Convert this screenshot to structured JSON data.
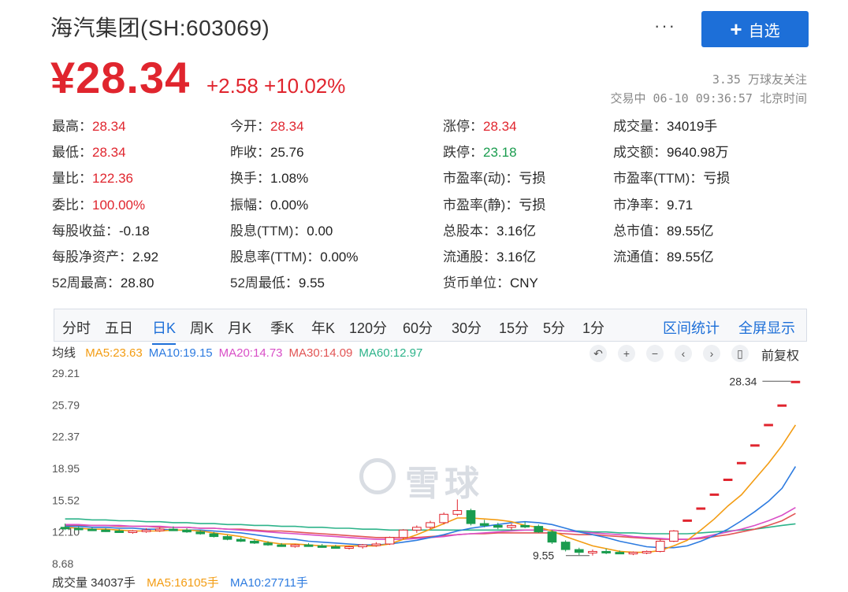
{
  "header": {
    "title": "海汽集团(SH:603069)",
    "more": "···",
    "add_button": "自选",
    "add_icon": "plus-icon"
  },
  "quote": {
    "price": "¥28.34",
    "change": "+2.58  +10.02%",
    "followers": "3.35 万球友关注",
    "trade_time": "交易中 06-10 09:36:57 北京时间"
  },
  "stats": [
    {
      "label": "最高：",
      "value": "28.34",
      "color": "red"
    },
    {
      "label": "今开：",
      "value": "28.34",
      "color": "red"
    },
    {
      "label": "涨停：",
      "value": "28.34",
      "color": "red"
    },
    {
      "label": "成交量：",
      "value": "34019手",
      "color": ""
    },
    {
      "label": "最低：",
      "value": "28.34",
      "color": "red"
    },
    {
      "label": "昨收：",
      "value": "25.76",
      "color": ""
    },
    {
      "label": "跌停：",
      "value": "23.18",
      "color": "green"
    },
    {
      "label": "成交额：",
      "value": "9640.98万",
      "color": ""
    },
    {
      "label": "量比：",
      "value": "122.36",
      "color": "red"
    },
    {
      "label": "换手：",
      "value": "1.08%",
      "color": ""
    },
    {
      "label": "市盈率(动)：",
      "value": "亏损",
      "color": ""
    },
    {
      "label": "市盈率(TTM)：",
      "value": "亏损",
      "color": ""
    },
    {
      "label": "委比：",
      "value": "100.00%",
      "color": "red"
    },
    {
      "label": "振幅：",
      "value": "0.00%",
      "color": ""
    },
    {
      "label": "市盈率(静)：",
      "value": "亏损",
      "color": ""
    },
    {
      "label": "市净率：",
      "value": "9.71",
      "color": ""
    },
    {
      "label": "每股收益：",
      "value": "-0.18",
      "color": ""
    },
    {
      "label": "股息(TTM)：",
      "value": "0.00",
      "color": ""
    },
    {
      "label": "总股本：",
      "value": "3.16亿",
      "color": ""
    },
    {
      "label": "总市值：",
      "value": "89.55亿",
      "color": ""
    },
    {
      "label": "每股净资产：",
      "value": "2.92",
      "color": ""
    },
    {
      "label": "股息率(TTM)：",
      "value": "0.00%",
      "color": ""
    },
    {
      "label": "流通股：",
      "value": "3.16亿",
      "color": ""
    },
    {
      "label": "流通值：",
      "value": "89.55亿",
      "color": ""
    },
    {
      "label": "52周最高：",
      "value": "28.80",
      "color": ""
    },
    {
      "label": "52周最低：",
      "value": "9.55",
      "color": ""
    },
    {
      "label": "货币单位：",
      "value": "CNY",
      "color": ""
    }
  ],
  "tabs": [
    "分时",
    "五日",
    "日K",
    "周K",
    "月K",
    "季K",
    "年K",
    "120分",
    "60分",
    "30分",
    "15分",
    "5分",
    "1分"
  ],
  "active_tab": "日K",
  "tab_links": [
    "区间统计",
    "全屏显示"
  ],
  "ma": {
    "label": "均线",
    "items": [
      {
        "text": "MA5:23.63",
        "color": "#f39c12"
      },
      {
        "text": "MA10:19.15",
        "color": "#2d7be0"
      },
      {
        "text": "MA20:14.73",
        "color": "#d94fc7"
      },
      {
        "text": "MA30:14.09",
        "color": "#e25555"
      },
      {
        "text": "MA60:12.97",
        "color": "#2db38a"
      }
    ]
  },
  "chart_tools": [
    "undo-icon",
    "zoom-in-icon",
    "zoom-out-icon",
    "prev-icon",
    "next-icon",
    "fullscreen-icon"
  ],
  "chart_tool_glyphs": [
    "↶",
    "+",
    "−",
    "‹",
    "›",
    "▯"
  ],
  "adjust_label": "前复权",
  "volume": {
    "label": "成交量 34037手",
    "ma5": "MA5:16105手",
    "ma10": "MA10:27711手"
  },
  "watermark": "雪球",
  "chart_data": {
    "type": "candlestick",
    "y_ticks": [
      "29.21",
      "25.79",
      "22.37",
      "18.95",
      "15.52",
      "12.10",
      "8.68"
    ],
    "ylim": [
      8.68,
      29.21
    ],
    "annotations": {
      "high": "28.34",
      "low": "9.55"
    },
    "colors": {
      "up": "#e0252e",
      "down": "#1a9c4e",
      "ma5": "#f39c12",
      "ma10": "#2d7be0",
      "ma20": "#d94fc7",
      "ma30": "#e25555",
      "ma60": "#2db38a"
    },
    "candles": [
      [
        12.6,
        13.0,
        12.3,
        12.5
      ],
      [
        12.5,
        12.7,
        12.3,
        12.4
      ],
      [
        12.4,
        12.6,
        12.2,
        12.3
      ],
      [
        12.3,
        12.5,
        12.1,
        12.2
      ],
      [
        12.2,
        12.4,
        12.0,
        12.1
      ],
      [
        12.1,
        12.3,
        11.9,
        12.2
      ],
      [
        12.2,
        12.5,
        12.0,
        12.3
      ],
      [
        12.3,
        12.6,
        12.1,
        12.4
      ],
      [
        12.4,
        12.7,
        12.2,
        12.3
      ],
      [
        12.3,
        12.5,
        12.0,
        12.1
      ],
      [
        12.1,
        12.3,
        11.8,
        11.9
      ],
      [
        11.9,
        12.1,
        11.5,
        11.6
      ],
      [
        11.6,
        11.8,
        11.2,
        11.3
      ],
      [
        11.3,
        11.5,
        11.0,
        11.1
      ],
      [
        11.1,
        11.3,
        10.8,
        10.9
      ],
      [
        10.9,
        11.1,
        10.6,
        10.7
      ],
      [
        10.7,
        10.9,
        10.5,
        10.6
      ],
      [
        10.6,
        10.8,
        10.4,
        10.7
      ],
      [
        10.7,
        10.9,
        10.5,
        10.6
      ],
      [
        10.6,
        10.8,
        10.4,
        10.5
      ],
      [
        10.5,
        10.7,
        10.3,
        10.4
      ],
      [
        10.4,
        10.6,
        10.2,
        10.5
      ],
      [
        10.5,
        10.8,
        10.3,
        10.7
      ],
      [
        10.7,
        11.0,
        10.5,
        10.8
      ],
      [
        10.8,
        11.6,
        10.7,
        11.5
      ],
      [
        11.5,
        12.4,
        11.3,
        12.3
      ],
      [
        12.3,
        12.8,
        12.0,
        12.6
      ],
      [
        12.6,
        13.3,
        12.4,
        13.1
      ],
      [
        13.1,
        14.2,
        12.9,
        14.0
      ],
      [
        14.0,
        15.6,
        13.8,
        14.4
      ],
      [
        14.4,
        14.6,
        12.8,
        13.0
      ],
      [
        13.0,
        13.4,
        12.6,
        12.8
      ],
      [
        12.8,
        13.1,
        12.4,
        12.6
      ],
      [
        12.6,
        13.0,
        12.3,
        12.8
      ],
      [
        12.8,
        13.2,
        12.5,
        12.7
      ],
      [
        12.7,
        12.9,
        12.0,
        12.1
      ],
      [
        12.1,
        12.3,
        10.8,
        11.0
      ],
      [
        11.0,
        11.2,
        10.0,
        10.2
      ],
      [
        10.2,
        10.4,
        9.6,
        9.9
      ],
      [
        9.9,
        10.2,
        9.55,
        10.0
      ],
      [
        10.0,
        10.3,
        9.7,
        9.9
      ],
      [
        9.9,
        10.1,
        9.7,
        9.8
      ],
      [
        9.8,
        10.0,
        9.6,
        9.9
      ],
      [
        9.9,
        10.1,
        9.7,
        10.0
      ],
      [
        10.0,
        11.3,
        9.9,
        11.1
      ],
      [
        11.1,
        12.3,
        11.0,
        12.2
      ],
      [
        13.4,
        13.4,
        13.4,
        13.4
      ],
      [
        14.7,
        14.7,
        14.7,
        14.7
      ],
      [
        16.2,
        16.2,
        16.2,
        16.2
      ],
      [
        17.8,
        17.8,
        17.8,
        17.8
      ],
      [
        19.6,
        19.6,
        19.6,
        19.6
      ],
      [
        21.5,
        21.5,
        21.5,
        21.5
      ],
      [
        23.7,
        23.7,
        23.7,
        23.7
      ],
      [
        25.8,
        25.8,
        25.8,
        25.8
      ],
      [
        28.34,
        28.34,
        28.34,
        28.34
      ]
    ],
    "ma5": [
      12.6,
      12.5,
      12.4,
      12.4,
      12.3,
      12.2,
      12.2,
      12.2,
      12.3,
      12.3,
      12.2,
      12.0,
      11.8,
      11.6,
      11.3,
      11.0,
      10.8,
      10.8,
      10.7,
      10.6,
      10.6,
      10.6,
      10.6,
      10.6,
      10.8,
      11.3,
      11.8,
      12.4,
      13.0,
      13.6,
      13.6,
      13.5,
      13.4,
      13.2,
      12.8,
      12.6,
      12.2,
      11.6,
      11.1,
      10.6,
      10.3,
      10.0,
      9.9,
      9.9,
      10.1,
      10.6,
      11.2,
      12.3,
      13.5,
      14.9,
      16.1,
      17.8,
      19.5,
      21.4,
      23.63
    ],
    "ma10": [
      12.7,
      12.7,
      12.6,
      12.6,
      12.5,
      12.5,
      12.4,
      12.4,
      12.3,
      12.3,
      12.3,
      12.2,
      12.1,
      12.0,
      11.8,
      11.6,
      11.4,
      11.3,
      11.1,
      11.0,
      10.9,
      10.8,
      10.7,
      10.7,
      10.8,
      11.0,
      11.2,
      11.5,
      11.8,
      12.2,
      12.5,
      12.7,
      12.9,
      13.1,
      13.2,
      13.1,
      12.9,
      12.5,
      12.1,
      11.8,
      11.5,
      11.1,
      10.8,
      10.5,
      10.4,
      10.4,
      10.6,
      11.1,
      11.7,
      12.4,
      13.3,
      14.3,
      15.4,
      16.8,
      19.15
    ],
    "ma20": [
      12.9,
      12.9,
      12.8,
      12.8,
      12.8,
      12.7,
      12.7,
      12.7,
      12.6,
      12.6,
      12.5,
      12.5,
      12.4,
      12.3,
      12.2,
      12.1,
      12.0,
      11.9,
      11.8,
      11.7,
      11.6,
      11.5,
      11.4,
      11.3,
      11.3,
      11.3,
      11.4,
      11.5,
      11.6,
      11.8,
      11.9,
      12.0,
      12.1,
      12.2,
      12.3,
      12.3,
      12.3,
      12.2,
      12.1,
      12.0,
      11.9,
      11.8,
      11.6,
      11.5,
      11.4,
      11.3,
      11.3,
      11.5,
      11.8,
      12.1,
      12.4,
      12.8,
      13.3,
      13.9,
      14.73
    ],
    "ma30": [
      12.8,
      12.8,
      12.8,
      12.8,
      12.7,
      12.7,
      12.7,
      12.6,
      12.6,
      12.6,
      12.5,
      12.5,
      12.4,
      12.4,
      12.3,
      12.2,
      12.2,
      12.1,
      12.0,
      11.9,
      11.8,
      11.7,
      11.6,
      11.5,
      11.5,
      11.5,
      11.5,
      11.6,
      11.7,
      11.8,
      11.9,
      11.9,
      12.0,
      12.0,
      12.0,
      12.0,
      12.0,
      11.9,
      11.8,
      11.8,
      11.7,
      11.6,
      11.5,
      11.4,
      11.3,
      11.3,
      11.3,
      11.4,
      11.6,
      11.8,
      12.1,
      12.4,
      12.8,
      13.3,
      14.09
    ],
    "ma60": [
      13.5,
      13.5,
      13.4,
      13.4,
      13.3,
      13.3,
      13.2,
      13.2,
      13.1,
      13.1,
      13.0,
      13.0,
      12.9,
      12.9,
      12.8,
      12.8,
      12.7,
      12.7,
      12.6,
      12.6,
      12.5,
      12.5,
      12.4,
      12.4,
      12.3,
      12.3,
      12.3,
      12.3,
      12.3,
      12.3,
      12.3,
      12.3,
      12.3,
      12.3,
      12.3,
      12.3,
      12.3,
      12.2,
      12.2,
      12.1,
      12.1,
      12.0,
      12.0,
      11.9,
      11.9,
      11.9,
      11.9,
      12.0,
      12.1,
      12.2,
      12.3,
      12.4,
      12.6,
      12.8,
      12.97
    ]
  }
}
